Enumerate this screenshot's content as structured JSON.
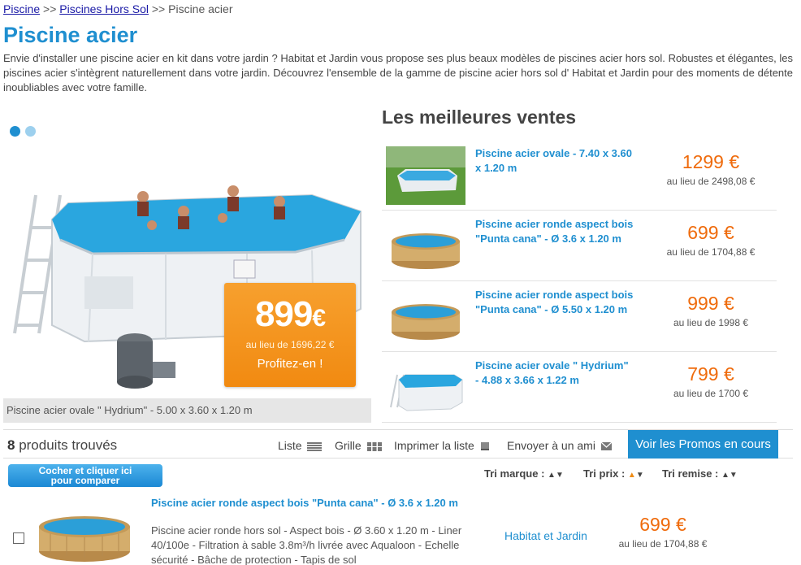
{
  "breadcrumb": {
    "items": [
      {
        "label": "Piscine"
      },
      {
        "label": "Piscines Hors Sol"
      },
      {
        "label": "Piscine acier"
      }
    ],
    "separator": ">>"
  },
  "page": {
    "title": "Piscine acier",
    "intro": "Envie d'installer une piscine acier en kit dans votre jardin ? Habitat et Jardin vous propose ses plus beaux modèles de piscines acier hors sol. Robustes et élégantes, les piscines acier s'intègrent naturellement dans votre jardin. Découvrez l'ensemble de la gamme de piscine acier hors sol d' Habitat et Jardin pour des moments de détente inoubliables avec votre famille."
  },
  "hero": {
    "price_amount": "899",
    "price_currency": "€",
    "was": "au lieu de 1696,22 €",
    "cta": "Profitez-en !",
    "caption": "Piscine acier ovale \" Hydrium\" - 5.00 x 3.60 x 1.20 m",
    "slides_count": 2,
    "active_slide": 1
  },
  "best_sellers": {
    "title": "Les meilleures ventes",
    "items": [
      {
        "name": "Piscine acier ovale - 7.40 x 3.60 x 1.20 m",
        "price": "1299 €",
        "was": "au lieu de 2498,08 €"
      },
      {
        "name": "Piscine acier ronde aspect bois \"Punta cana\" - Ø 3.6 x 1.20 m",
        "price": "699 €",
        "was": "au lieu de 1704,88 €"
      },
      {
        "name": "Piscine acier ronde aspect bois \"Punta cana\" - Ø 5.50 x 1.20 m",
        "price": "999 €",
        "was": "au lieu de 1998 €"
      },
      {
        "name": "Piscine acier ovale \" Hydrium\" - 4.88 x 3.66 x 1.22 m",
        "price": "799 €",
        "was": "au lieu de 1700 €"
      }
    ]
  },
  "toolbar": {
    "count_number": "8",
    "count_label": " produits trouvés",
    "list_label": "Liste",
    "grid_label": "Grille",
    "print_label": "Imprimer la liste",
    "send_label": "Envoyer à un ami",
    "promos_label": "Voir les Promos en cours"
  },
  "compare": {
    "line1": "Cocher et cliquer ici",
    "line2": "pour comparer"
  },
  "sort": {
    "brand": "Tri marque :",
    "price": "Tri prix :",
    "discount": "Tri remise :"
  },
  "product": {
    "name": "Piscine acier ronde aspect bois \"Punta cana\" - Ø 3.6 x 1.20 m",
    "description": "Piscine acier ronde hors sol - Aspect bois - Ø 3.60 x 1.20 m - Liner 40/100e - Filtration à sable 3.8m³/h livrée avec Aqualoon - Echelle sécurité - Bâche de protection - Tapis de sol",
    "brand": "Habitat et Jardin",
    "price": "699 €",
    "was": "au lieu de 1704,88 €"
  },
  "colors": {
    "accent": "#1f8fd0",
    "price": "#ef6b0c",
    "promo": "#f18a11"
  },
  "icons": {
    "list": "list-icon",
    "grid": "grid-icon",
    "print": "print-icon",
    "mail": "mail-icon"
  }
}
